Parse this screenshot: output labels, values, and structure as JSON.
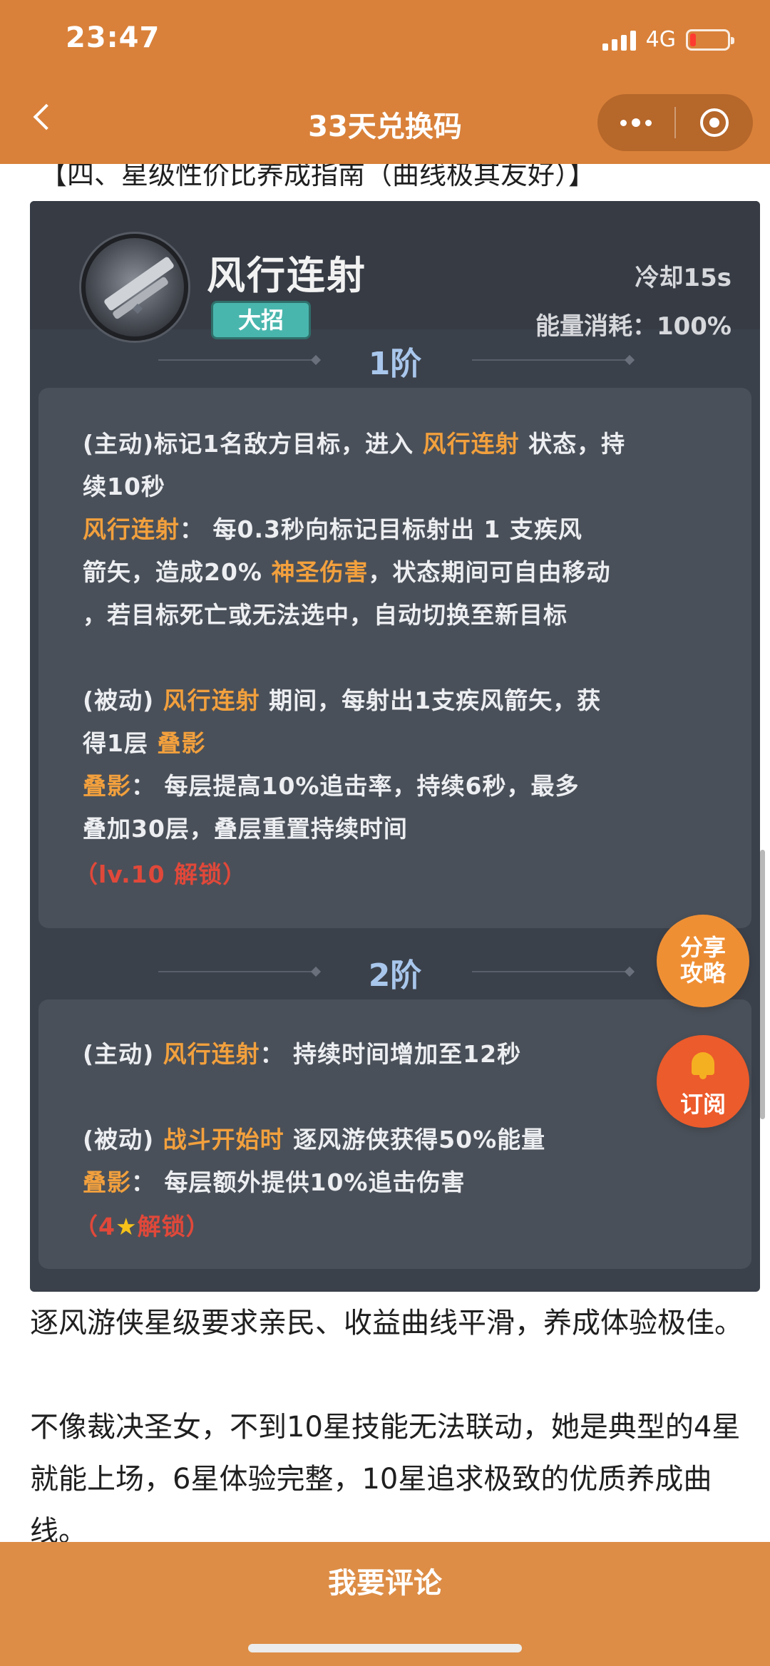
{
  "status_bar": {
    "time": "23:47",
    "network": "4G"
  },
  "nav": {
    "title": "33天兑换码"
  },
  "article": {
    "section_heading": "【四、星级性价比养成指南（曲线极其友好）】",
    "skill": {
      "name": "风行连射",
      "badge": "大招",
      "cooldown": "冷却15s",
      "energy": "能量消耗：100%",
      "tier1": {
        "label": "1阶",
        "l1a": "(主动)标记1名敌方目标，进入 ",
        "l1b": "风行连射",
        "l1c": " 状态，持",
        "l2": "续10秒",
        "l3a": "风行连射",
        "l3b": "：  每0.3秒向标记目标射出 1 支疾风",
        "l4a": "箭矢，造成20% ",
        "l4b": "神圣伤害",
        "l4c": "，状态期间可自由移动",
        "l5": "，若目标死亡或无法选中，自动切换至新目标",
        "l6a": "(被动) ",
        "l6b": "风行连射",
        "l6c": " 期间，每射出1支疾风箭矢，获",
        "l7a": "得1层 ",
        "l7b": "叠影",
        "l8a": "叠影",
        "l8b": "：  每层提高10%追击率，持续6秒，最多",
        "l9": "叠加30层，叠层重置持续时间",
        "unlock": "（lv.10 解锁）"
      },
      "tier2": {
        "label": "2阶",
        "l1a": "(主动) ",
        "l1b": "风行连射",
        "l1c": "：  持续时间增加至12秒",
        "l2a": "(被动) ",
        "l2b": "战斗开始时",
        "l2c": " 逐风游侠获得50%能量",
        "l3a": "叠影",
        "l3b": "：  每层额外提供10%追击伤害",
        "unlock_a": "（4",
        "unlock_star": "★",
        "unlock_b": "解锁）"
      }
    },
    "para1": "逐风游侠星级要求亲民、收益曲线平滑，养成体验极佳。",
    "para2": "不像裁决圣女，不到10星技能无法联动，她是典型的4星就能上场，6星体验完整，10星追求极致的优质养成曲线。"
  },
  "floating": {
    "share": "分享攻略",
    "subscribe": "订阅"
  },
  "bottom": {
    "comment_button": "我要评论"
  },
  "colors": {
    "brand": "#d9813a",
    "highlight": "#f2a03d",
    "unlock": "#e0483a",
    "tier_label": "#a9c7ec"
  },
  "icons": [
    "back-chevron-icon",
    "more-dots-icon",
    "close-circle-icon",
    "signal-icon",
    "battery-icon",
    "bell-icon",
    "skill-avatar-icon",
    "star-icon"
  ]
}
